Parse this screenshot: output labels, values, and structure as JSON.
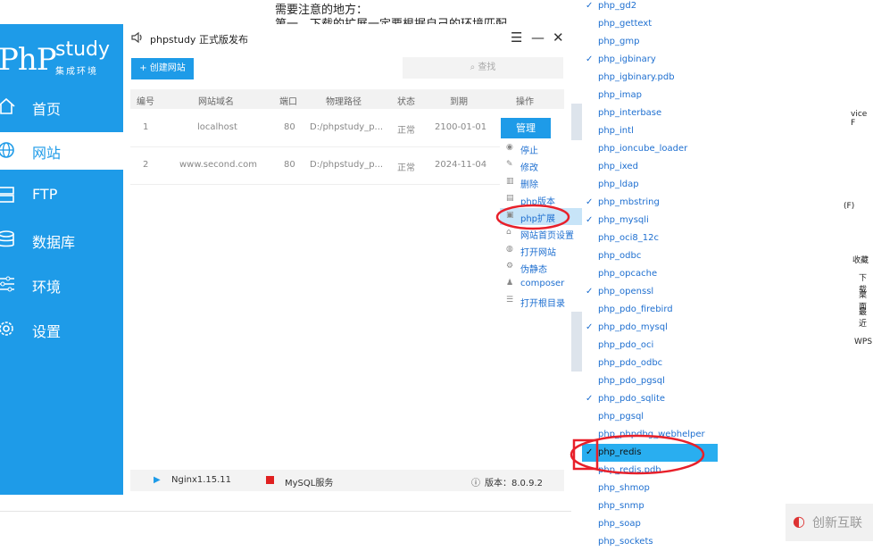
{
  "background_doc": {
    "line1": "需要注意的地方：",
    "line2": "第一、下载的扩展一定要根据自己的环境匹配"
  },
  "app": {
    "logo_main": "PhP",
    "logo_study": "study",
    "logo_sub": "集成环境",
    "title": "phpstudy 正式版发布",
    "brand_color": "#1e9be8",
    "nav": [
      {
        "label": "首页",
        "icon": "home-icon"
      },
      {
        "label": "网站",
        "icon": "globe-icon",
        "active": true
      },
      {
        "label": "FTP",
        "icon": "server-icon"
      },
      {
        "label": "数据库",
        "icon": "database-icon"
      },
      {
        "label": "环境",
        "icon": "sliders-icon"
      },
      {
        "label": "设置",
        "icon": "gear-icon"
      }
    ],
    "window_controls": {
      "menu": "☰",
      "minimize": "—",
      "close": "✕"
    },
    "create_button": "+ 创建网站",
    "search_placeholder": "查找",
    "table": {
      "headers": [
        "编号",
        "网站域名",
        "端口",
        "物理路径",
        "状态",
        "到期",
        "操作"
      ],
      "rows": [
        {
          "id": "1",
          "domain": "localhost",
          "port": "80",
          "path": "D:/phpstudy_p...",
          "status": "正常",
          "expire": "2100-01-01"
        },
        {
          "id": "2",
          "domain": "www.second.com",
          "port": "80",
          "path": "D:/phpstudy_p...",
          "status": "正常",
          "expire": "2024-11-04"
        }
      ],
      "manage_label": "管理"
    },
    "manage_menu": [
      {
        "label": "停止",
        "icon": "stop-icon"
      },
      {
        "label": "修改",
        "icon": "edit-icon"
      },
      {
        "label": "删除",
        "icon": "trash-icon"
      },
      {
        "label": "php版本",
        "icon": "php-version-icon"
      },
      {
        "label": "php扩展",
        "icon": "php-extension-icon",
        "highlighted": true
      },
      {
        "label": "网站首页设置",
        "icon": "home-icon"
      },
      {
        "label": "打开网站",
        "icon": "globe-icon"
      },
      {
        "label": "伪静态",
        "icon": "settings-icon"
      },
      {
        "label": "composer",
        "icon": "composer-icon"
      },
      {
        "label": "打开根目录",
        "icon": "folder-icon"
      }
    ],
    "status": {
      "nginx": "Nginx1.15.11",
      "mysql": "MySQL服务",
      "version": "版本：8.0.9.2"
    }
  },
  "extensions": [
    {
      "name": "php_gd2",
      "checked": true
    },
    {
      "name": "php_gettext",
      "checked": false
    },
    {
      "name": "php_gmp",
      "checked": false
    },
    {
      "name": "php_igbinary",
      "checked": true
    },
    {
      "name": "php_igbinary.pdb",
      "checked": false
    },
    {
      "name": "php_imap",
      "checked": false
    },
    {
      "name": "php_interbase",
      "checked": false
    },
    {
      "name": "php_intl",
      "checked": false
    },
    {
      "name": "php_ioncube_loader",
      "checked": false
    },
    {
      "name": "php_ixed",
      "checked": false
    },
    {
      "name": "php_ldap",
      "checked": false
    },
    {
      "name": "php_mbstring",
      "checked": true
    },
    {
      "name": "php_mysqli",
      "checked": true
    },
    {
      "name": "php_oci8_12c",
      "checked": false
    },
    {
      "name": "php_odbc",
      "checked": false
    },
    {
      "name": "php_opcache",
      "checked": false
    },
    {
      "name": "php_openssl",
      "checked": true
    },
    {
      "name": "php_pdo_firebird",
      "checked": false
    },
    {
      "name": "php_pdo_mysql",
      "checked": true
    },
    {
      "name": "php_pdo_oci",
      "checked": false
    },
    {
      "name": "php_pdo_odbc",
      "checked": false
    },
    {
      "name": "php_pdo_pgsql",
      "checked": false
    },
    {
      "name": "php_pdo_sqlite",
      "checked": true
    },
    {
      "name": "php_pgsql",
      "checked": false
    },
    {
      "name": "php_phpdbg_webhelper",
      "checked": false
    },
    {
      "name": "php_redis",
      "checked": true,
      "selected": true
    },
    {
      "name": "php_redis.pdb",
      "checked": false
    },
    {
      "name": "php_shmop",
      "checked": false
    },
    {
      "name": "php_snmp",
      "checked": false
    },
    {
      "name": "php_soap",
      "checked": false
    },
    {
      "name": "php_sockets",
      "checked": false
    }
  ],
  "background_right": {
    "a": "(F)",
    "b": "收藏",
    "c": "下载",
    "d": "桌面",
    "e": "最近",
    "f": "WPS",
    "g": "vice F"
  },
  "watermark": "创新互联",
  "annotation_color": "#e8202a"
}
